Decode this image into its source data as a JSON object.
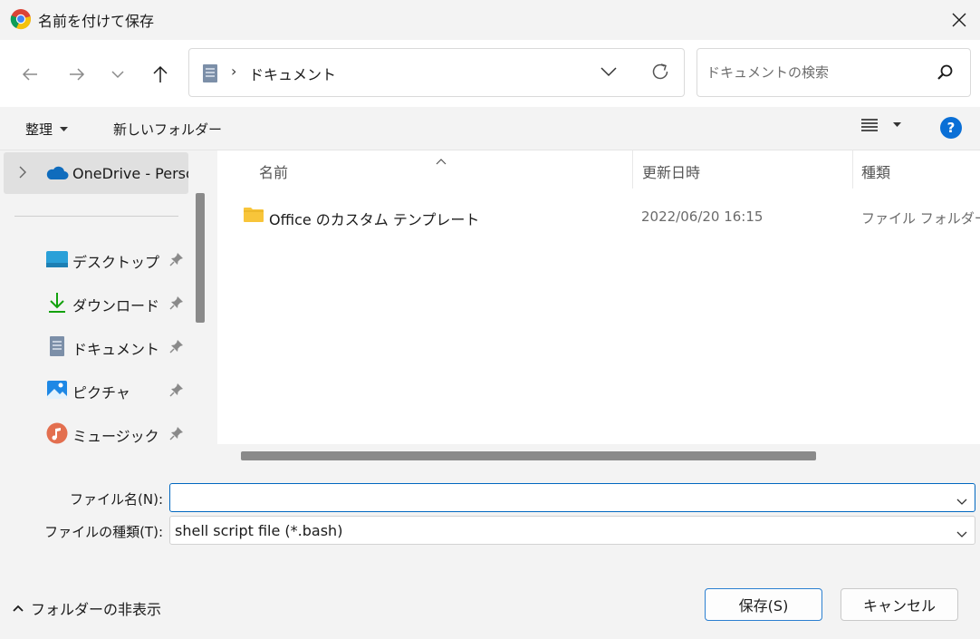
{
  "window": {
    "title": "名前を付けて保存",
    "app_icon": "chrome-icon"
  },
  "navigation": {
    "back": "back-arrow-icon",
    "forward": "forward-arrow-icon",
    "recent": "chevron-down-icon",
    "up": "up-arrow-icon",
    "address": {
      "separator": "›",
      "current": "ドキュメント"
    },
    "search_placeholder": "ドキュメントの検索"
  },
  "commands": {
    "organize": "整理",
    "new_folder": "新しいフォルダー"
  },
  "nav_pane": {
    "onedrive_label": "OneDrive - Perso",
    "quick_access": [
      {
        "label": "デスクトップ",
        "icon": "desktop-icon"
      },
      {
        "label": "ダウンロード",
        "icon": "download-icon"
      },
      {
        "label": "ドキュメント",
        "icon": "document-icon"
      },
      {
        "label": "ピクチャ",
        "icon": "pictures-icon"
      },
      {
        "label": "ミュージック",
        "icon": "music-icon"
      }
    ]
  },
  "columns": {
    "name": "名前",
    "modified": "更新日時",
    "type": "種類"
  },
  "files": [
    {
      "name": "Office のカスタム テンプレート",
      "modified": "2022/06/20 16:15",
      "type": "ファイル フォルダー"
    }
  ],
  "form": {
    "filename_label": "ファイル名(N):",
    "filename_value": "",
    "filetype_label": "ファイルの種類(T):",
    "filetype_value": "shell script file (*.bash)"
  },
  "footer": {
    "hide_folders": "フォルダーの非表示",
    "save": "保存(S)",
    "cancel": "キャンセル"
  },
  "colors": {
    "accent": "#0067c0",
    "help": "#0a6fd6",
    "folder": "#f8c53a"
  }
}
